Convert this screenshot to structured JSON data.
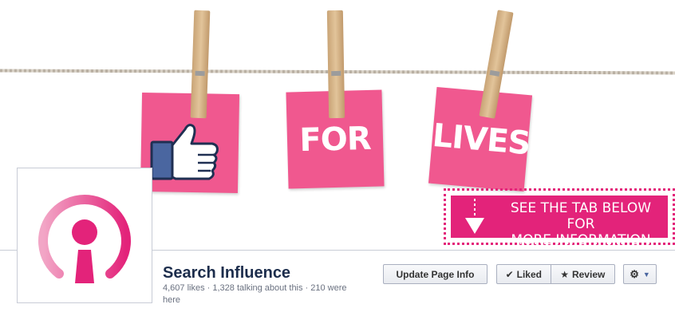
{
  "cover": {
    "notes": [
      "FOR",
      "LIVES"
    ],
    "info_tab": {
      "line1": "SEE THE TAB BELOW FOR",
      "line2": "MORE INFORMATION"
    },
    "accent_color": "#e3237a",
    "note_color": "#f0588f"
  },
  "page": {
    "name": "Search Influence",
    "stats": "4,607 likes · 1,328 talking about this · 210 were here"
  },
  "actions": {
    "update_label": "Update Page Info",
    "liked_label": "Liked",
    "review_label": "Review",
    "liked_icon": "checkmark-icon",
    "review_icon": "star-icon",
    "settings_icon": "gear-icon"
  }
}
